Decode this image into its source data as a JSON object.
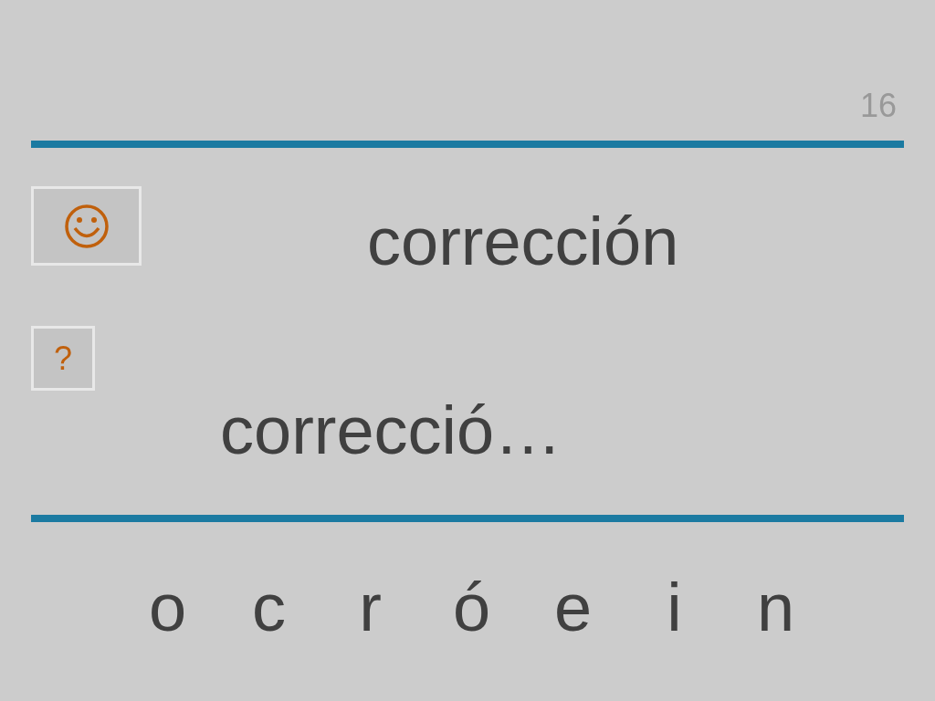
{
  "page_number": "16",
  "word": "corrección",
  "hint_button": "?",
  "answer": "correcció…",
  "letters": [
    "o",
    "c",
    "r",
    "ó",
    "e",
    "i",
    "n"
  ]
}
